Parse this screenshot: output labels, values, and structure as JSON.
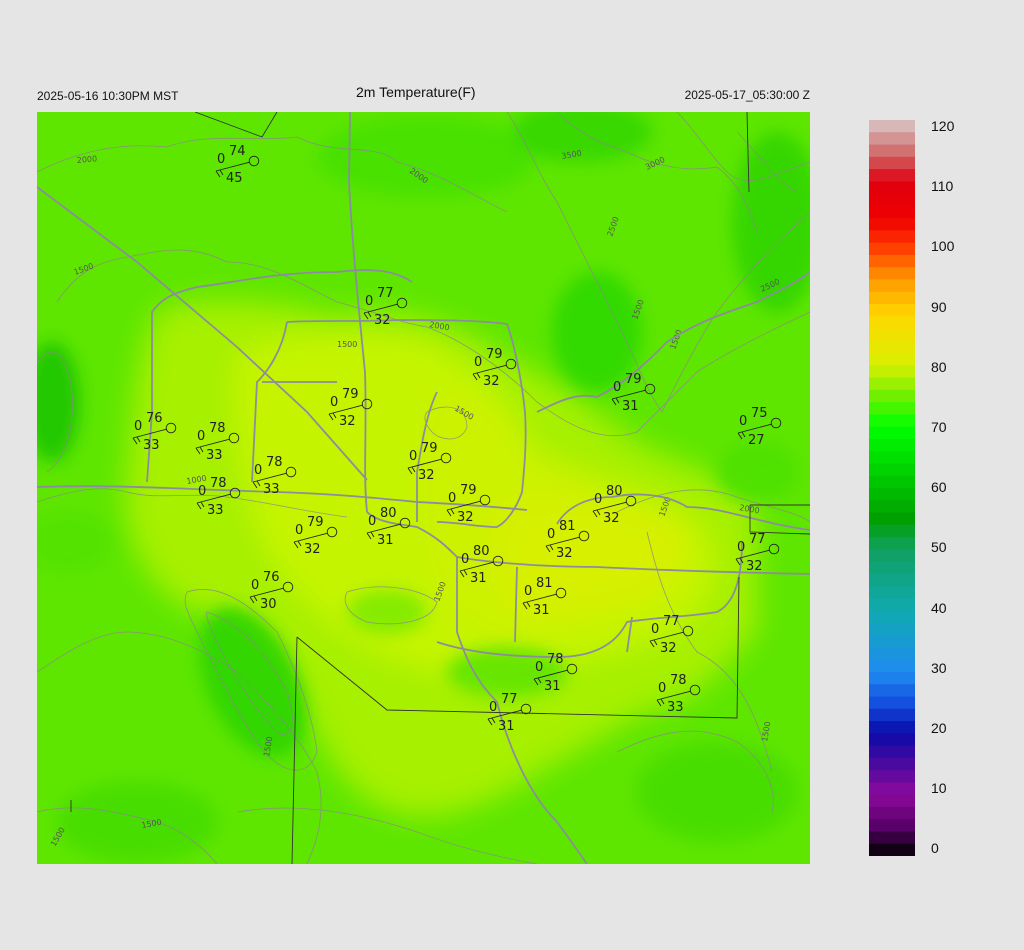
{
  "header": {
    "local_time": "2025-05-16 10:30PM MST",
    "title": "2m Temperature(F)",
    "valid_time": "2025-05-17_05:30:00 Z"
  },
  "colorbar": {
    "labels": [
      "120",
      "110",
      "100",
      "90",
      "80",
      "70",
      "60",
      "50",
      "40",
      "30",
      "20",
      "10",
      "0"
    ],
    "stops": [
      {
        "v": 0,
        "c": "#000000"
      },
      {
        "v": 5,
        "c": "#5a006a"
      },
      {
        "v": 10,
        "c": "#8c0a9c"
      },
      {
        "v": 15,
        "c": "#4a0aa0"
      },
      {
        "v": 20,
        "c": "#0a0aa8"
      },
      {
        "v": 25,
        "c": "#1450e0"
      },
      {
        "v": 30,
        "c": "#1e8cf0"
      },
      {
        "v": 40,
        "c": "#10aab0"
      },
      {
        "v": 50,
        "c": "#10a060"
      },
      {
        "v": 55,
        "c": "#00a000"
      },
      {
        "v": 60,
        "c": "#00c000"
      },
      {
        "v": 70,
        "c": "#00ff00"
      },
      {
        "v": 75,
        "c": "#70f000"
      },
      {
        "v": 80,
        "c": "#d8f000"
      },
      {
        "v": 88,
        "c": "#ffd800"
      },
      {
        "v": 94,
        "c": "#ff9800"
      },
      {
        "v": 100,
        "c": "#ff3000"
      },
      {
        "v": 104,
        "c": "#ee0000"
      },
      {
        "v": 110,
        "c": "#e00010"
      },
      {
        "v": 114,
        "c": "#d06060"
      },
      {
        "v": 120,
        "c": "#d8c8c8"
      }
    ]
  },
  "colors": {
    "background": "#e5e5e5",
    "map_base": "#5ee600",
    "contour": "#8a8a8a",
    "road": "#8c8ca0"
  },
  "contour_labels": [
    "2000",
    "3500",
    "3000",
    "2000",
    "2500",
    "1500",
    "1500",
    "2000",
    "2500",
    "1500",
    "1500",
    "1500",
    "1000",
    "1500",
    "2000",
    "1500",
    "1500",
    "1500",
    "1500",
    "1500"
  ],
  "stations": [
    {
      "t": "74",
      "d": "45",
      "z": "0"
    },
    {
      "t": "77",
      "d": "32",
      "z": "0"
    },
    {
      "t": "79",
      "d": "32",
      "z": "0"
    },
    {
      "t": "79",
      "d": "31",
      "z": "0"
    },
    {
      "t": "79",
      "d": "32",
      "z": "0"
    },
    {
      "t": "75",
      "d": "27",
      "z": "0"
    },
    {
      "t": "76",
      "d": "33",
      "z": "0"
    },
    {
      "t": "78",
      "d": "33",
      "z": "0"
    },
    {
      "t": "79",
      "d": "32",
      "z": "0"
    },
    {
      "t": "78",
      "d": "33",
      "z": "0"
    },
    {
      "t": "79",
      "d": "32",
      "z": "0"
    },
    {
      "t": "78",
      "d": "33",
      "z": "0"
    },
    {
      "t": "80",
      "d": "31",
      "z": "0"
    },
    {
      "t": "79",
      "d": "32",
      "z": "0"
    },
    {
      "t": "80",
      "d": "32",
      "z": "0"
    },
    {
      "t": "81",
      "d": "32",
      "z": "0"
    },
    {
      "t": "77",
      "d": "32",
      "z": "0"
    },
    {
      "t": "80",
      "d": "31",
      "z": "0"
    },
    {
      "t": "76",
      "d": "30",
      "z": "0"
    },
    {
      "t": "81",
      "d": "31",
      "z": "0"
    },
    {
      "t": "77",
      "d": "32",
      "z": "0"
    },
    {
      "t": "78",
      "d": "31",
      "z": "0"
    },
    {
      "t": "78",
      "d": "33",
      "z": "0"
    },
    {
      "t": "77",
      "d": "31",
      "z": "0"
    }
  ]
}
